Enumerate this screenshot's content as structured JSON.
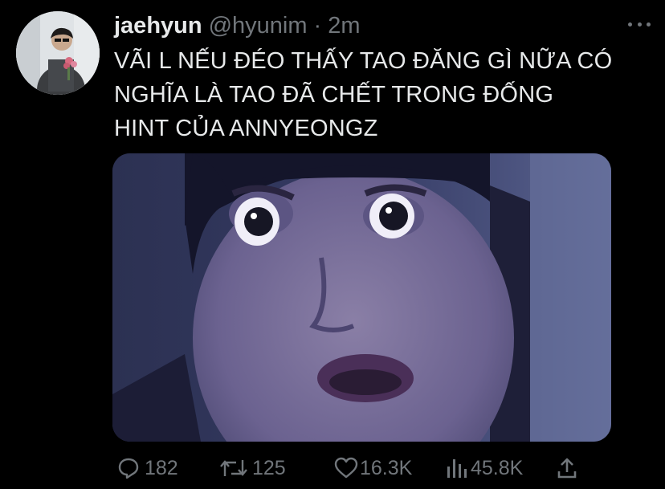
{
  "tweet": {
    "display_name": "jaehyun",
    "handle": "@hyunim",
    "separator": "·",
    "time": "2m",
    "text_lines": [
      "VÃI L NẾU ĐÉO THẤY TAO ĐĂNG GÌ NỮA CÓ",
      "NGHĨA LÀ TAO ĐÃ CHẾT TRONG ĐỐNG",
      "HINT CỦA ANNYEONGZ"
    ]
  },
  "actions": {
    "replies": "182",
    "retweets": "125",
    "likes": "16.3K",
    "views": "45.8K"
  },
  "icons": {
    "reply": "reply-icon",
    "retweet": "retweet-icon",
    "like": "heart-icon",
    "views": "views-icon",
    "share": "share-icon",
    "more": "more-options-icon"
  },
  "colors": {
    "background": "#000000",
    "primary_text": "#e7e9ea",
    "secondary_text": "#71767b"
  }
}
